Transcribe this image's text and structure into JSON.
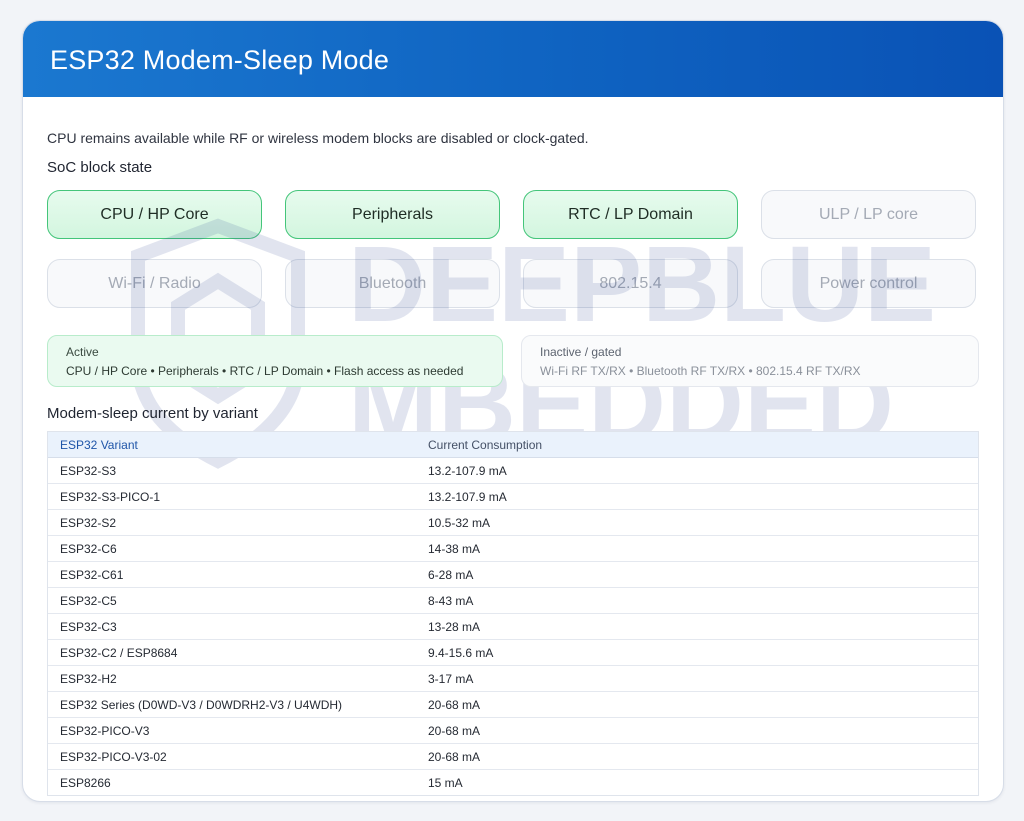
{
  "header": {
    "title": "ESP32 Modem-Sleep Mode"
  },
  "subtitle": "CPU remains available while RF or wireless modem blocks are disabled or clock-gated.",
  "block_state_label": "SoC block state",
  "blocks": [
    {
      "label": "CPU / HP Core",
      "state": "active"
    },
    {
      "label": "Peripherals",
      "state": "active"
    },
    {
      "label": "RTC / LP Domain",
      "state": "active"
    },
    {
      "label": "ULP / LP core",
      "state": "inactive"
    },
    {
      "label": "Wi-Fi / Radio",
      "state": "inactive"
    },
    {
      "label": "Bluetooth",
      "state": "inactive"
    },
    {
      "label": "802.15.4",
      "state": "inactive"
    },
    {
      "label": "Power control",
      "state": "inactive"
    }
  ],
  "legend": {
    "active_title": "Active",
    "active_desc": "CPU / HP Core • Peripherals • RTC / LP Domain • Flash access as needed",
    "inactive_title": "Inactive / gated",
    "inactive_desc": "Wi-Fi RF TX/RX • Bluetooth RF TX/RX • 802.15.4 RF TX/RX"
  },
  "table": {
    "title": "Modem-sleep current by variant",
    "columns": [
      "ESP32 Variant",
      "Current Consumption"
    ],
    "rows": [
      [
        "ESP32-S3",
        "13.2-107.9 mA"
      ],
      [
        "ESP32-S3-PICO-1",
        "13.2-107.9 mA"
      ],
      [
        "ESP32-S2",
        "10.5-32 mA"
      ],
      [
        "ESP32-C6",
        "14-38 mA"
      ],
      [
        "ESP32-C61",
        "6-28 mA"
      ],
      [
        "ESP32-C5",
        "8-43 mA"
      ],
      [
        "ESP32-C3",
        "13-28 mA"
      ],
      [
        "ESP32-C2 / ESP8684",
        "9.4-15.6 mA"
      ],
      [
        "ESP32-H2",
        "3-17 mA"
      ],
      [
        "ESP32 Series (D0WD-V3 / D0WDRH2-V3 / U4WDH)",
        "20-68 mA"
      ],
      [
        "ESP32-PICO-V3",
        "20-68 mA"
      ],
      [
        "ESP32-PICO-V3-02",
        "20-68 mA"
      ],
      [
        "ESP8266",
        "15 mA"
      ]
    ]
  },
  "watermark": {
    "line1": "DEEPBLUE",
    "line2": "MBEDDED"
  },
  "colors": {
    "header_start": "#1b78d0",
    "header_end": "#0a52b5",
    "active_border": "#44c57a",
    "active_fill": "#d3f6df",
    "inactive_border": "#dbe0e8",
    "table_header": "#eaf2fc"
  }
}
